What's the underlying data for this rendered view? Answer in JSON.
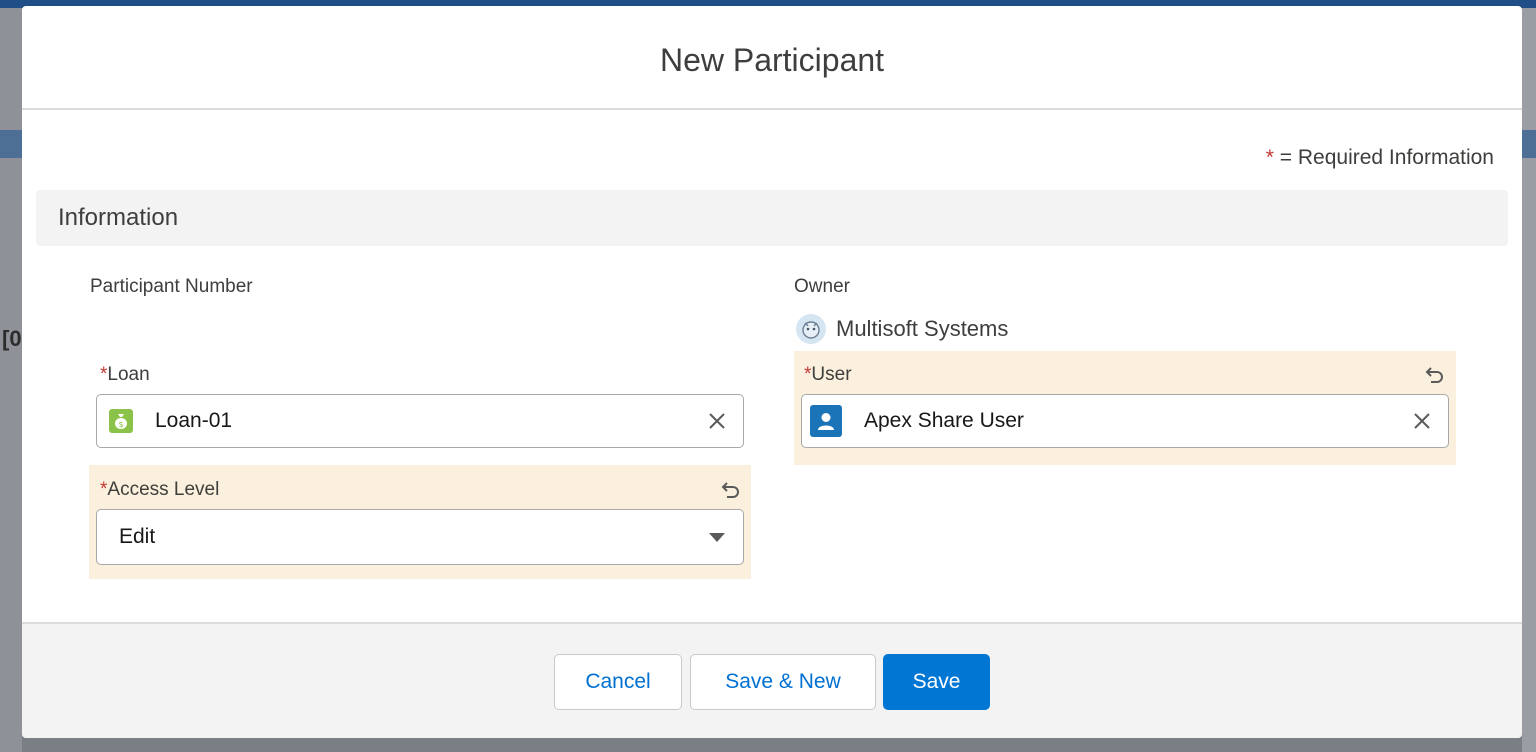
{
  "modal": {
    "title": "New Participant",
    "required_legend": "= Required Information",
    "asterisk": "*",
    "section_title": "Information"
  },
  "fields": {
    "participant_number": {
      "label": "Participant Number"
    },
    "owner": {
      "label": "Owner",
      "name": "Multisoft Systems",
      "icon": "user-avatar-icon"
    },
    "loan": {
      "label": "Loan",
      "value": "Loan-01",
      "icon": "money-bag-icon",
      "icon_color": "#8bc34a"
    },
    "user": {
      "label": "User",
      "value": "Apex Share User",
      "icon": "user-icon",
      "icon_color": "#1b74b8"
    },
    "access_level": {
      "label": "Access Level",
      "value": "Edit"
    }
  },
  "footer": {
    "cancel_label": "Cancel",
    "save_new_label": "Save & New",
    "save_label": "Save"
  },
  "colors": {
    "brand": "#0176d3",
    "changed_highlight": "#faf0dd",
    "required": "#c23934"
  }
}
